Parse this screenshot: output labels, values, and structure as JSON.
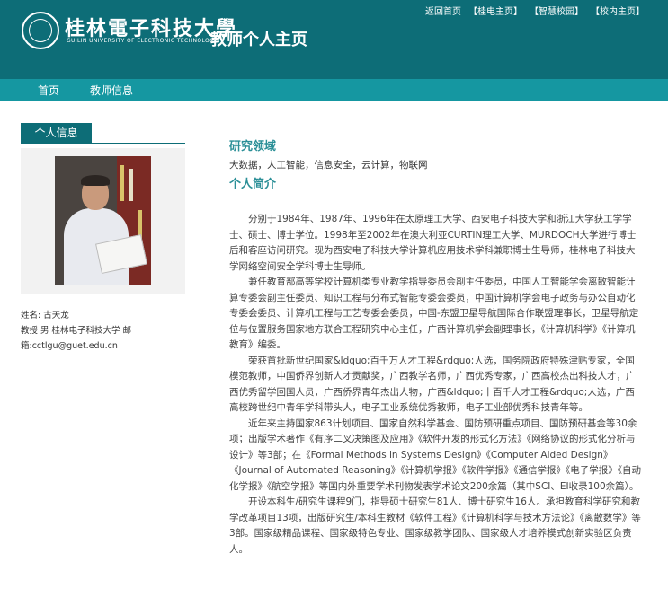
{
  "header": {
    "logo_text": "桂林電子科技大學",
    "logo_subtitle": "GUILIN UNIVERSITY OF ELECTRONIC TECHNOLOGY",
    "site_title": "教师个人主页",
    "top_links": [
      "返回首页",
      "【桂电主页】",
      "【智慧校园】",
      "【校内主页】"
    ]
  },
  "nav": {
    "items": [
      "首页",
      "教师信息"
    ]
  },
  "sidebar": {
    "tab_label": "个人信息",
    "lines": [
      "姓名:  古天龙",
      "教授 男 桂林电子科技大学 邮",
      "箱:cctlgu@guet.edu.cn"
    ]
  },
  "main": {
    "research_heading": "研究领域",
    "research_fields": "大数据，人工智能，信息安全，云计算，物联网",
    "profile_heading": "个人简介",
    "paragraphs": [
      "分别于1984年、1987年、1996年在太原理工大学、西安电子科技大学和浙江大学获工学学士、硕士、博士学位。1998年至2002年在澳大利亚CURTIN理工大学、MURDOCH大学进行博士后和客座访问研究。现为西安电子科技大学计算机应用技术学科兼职博士生导师，桂林电子科技大学网络空间安全学科博士生导师。",
      "兼任教育部高等学校计算机类专业教学指导委员会副主任委员，中国人工智能学会离散智能计算专委会副主任委员、知识工程与分布式智能专委会委员，中国计算机学会电子政务与办公自动化专委会委员、计算机工程与工艺专委会委员，中国-东盟卫星导航国际合作联盟理事长，卫星导航定位与位置服务国家地方联合工程研究中心主任，广西计算机学会副理事长，《计算机科学》《计算机教育》编委。",
      "荣获首批新世纪国家&ldquo;百千万人才工程&rdquo;人选，国务院政府特殊津贴专家，全国模范教师，中国侨界创新人才贡献奖，广西教学名师，广西优秀专家，广西高校杰出科技人才，广西优秀留学回国人员，广西侨界青年杰出人物，广西&ldquo;十百千人才工程&rdquo;人选，广西高校跨世纪中青年学科带头人，电子工业系统优秀教师，电子工业部优秀科技青年等。",
      "近年来主持国家863计划项目、国家自然科学基金、国防预研重点项目、国防预研基金等30余项；出版学术著作《有序二叉决策图及应用》《软件开发的形式化方法》《网络协议的形式化分析与设计》等3部；在《Formal Methods in Systems Design》《Computer Aided Design》《Journal of Automated Reasoning》《计算机学报》《软件学报》《通信学报》《电子学报》《自动化学报》《航空学报》等国内外重要学术刊物发表学术论文200余篇（其中SCI、EI收录100余篇）。",
      "开设本科生/研究生课程9门，指导硕士研究生81人、博士研究生16人。承担教育科学研究和教学改革项目13项，出版研究生/本科生教材《软件工程》《计算机科学与技术方法论》《离散数学》等3部。国家级精品课程、国家级特色专业、国家级教学团队、国家级人才培养模式创新实验区负责人。"
    ]
  },
  "colors": {
    "header_bg": "#0d6d77",
    "nav_bg": "#1597a1",
    "heading": "#2b8f97"
  }
}
